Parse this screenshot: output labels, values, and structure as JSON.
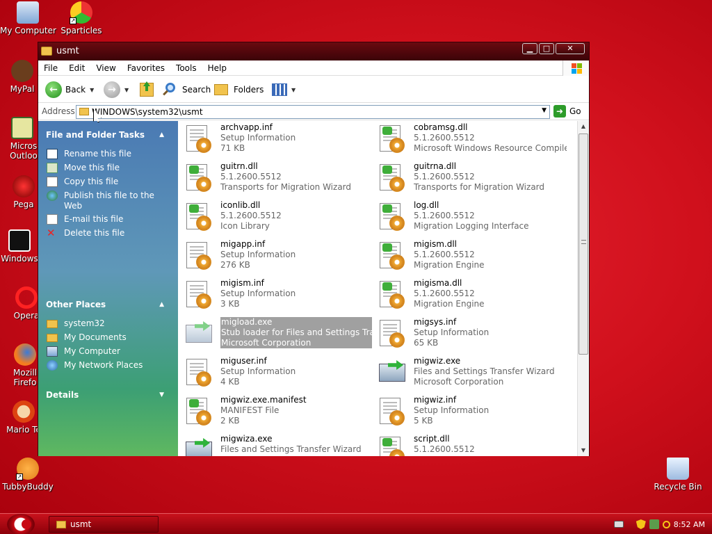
{
  "desktop": {
    "icons": [
      {
        "label": "My Computer"
      },
      {
        "label": "Sparticles"
      },
      {
        "label": "MyPal"
      },
      {
        "label": "Micros Outloo"
      },
      {
        "label": "Pega"
      },
      {
        "label": "Windows"
      },
      {
        "label": "Opera"
      },
      {
        "label": "Mozill Firefo"
      },
      {
        "label": "Mario Te"
      },
      {
        "label": "TubbyBuddy"
      },
      {
        "label": "Recycle Bin"
      }
    ]
  },
  "window": {
    "title": "usmt",
    "controls": {
      "minimize": "▁",
      "maximize": "□",
      "close": "✕"
    },
    "menu": [
      "File",
      "Edit",
      "View",
      "Favorites",
      "Tools",
      "Help"
    ],
    "toolbar": {
      "back": "Back",
      "search": "Search",
      "folders": "Folders"
    },
    "address": {
      "label": "Address",
      "value": "WINDOWS\\system32\\usmt",
      "go": "Go"
    }
  },
  "taskpane": {
    "file_folder_tasks": {
      "title": "File and Folder Tasks",
      "items": [
        "Rename this file",
        "Move this file",
        "Copy this file",
        "Publish this file to the Web",
        "E-mail this file",
        "Delete this file"
      ]
    },
    "other_places": {
      "title": "Other Places",
      "items": [
        "system32",
        "My Documents",
        "My Computer",
        "My Network Places"
      ]
    },
    "details": {
      "title": "Details"
    }
  },
  "files": [
    {
      "name": "archvapp.inf",
      "line2": "Setup Information",
      "line3": "71 KB",
      "icon": "setup-inf-icon"
    },
    {
      "name": "cobramsg.dll",
      "line2": "5.1.2600.5512",
      "line3": "Microsoft Windows Resource Compiler ...",
      "icon": "dll-icon"
    },
    {
      "name": "guitrn.dll",
      "line2": "5.1.2600.5512",
      "line3": "Transports for Migration Wizard",
      "icon": "dll-icon"
    },
    {
      "name": "guitrna.dll",
      "line2": "5.1.2600.5512",
      "line3": "Transports for Migration Wizard",
      "icon": "dll-icon"
    },
    {
      "name": "iconlib.dll",
      "line2": "5.1.2600.5512",
      "line3": "Icon Library",
      "icon": "dll-icon"
    },
    {
      "name": "log.dll",
      "line2": "5.1.2600.5512",
      "line3": "Migration Logging Interface",
      "icon": "dll-icon"
    },
    {
      "name": "migapp.inf",
      "line2": "Setup Information",
      "line3": "276 KB",
      "icon": "setup-inf-icon"
    },
    {
      "name": "migism.dll",
      "line2": "5.1.2600.5512",
      "line3": "Migration Engine",
      "icon": "dll-icon"
    },
    {
      "name": "migism.inf",
      "line2": "Setup Information",
      "line3": "3 KB",
      "icon": "setup-inf-icon"
    },
    {
      "name": "migisma.dll",
      "line2": "5.1.2600.5512",
      "line3": "Migration Engine",
      "icon": "dll-icon"
    },
    {
      "name": "migload.exe",
      "line2": "Stub loader for Files and Settings Transf...",
      "line3": "Microsoft Corporation",
      "icon": "exe-icon",
      "selected": true
    },
    {
      "name": "migsys.inf",
      "line2": "Setup Information",
      "line3": "65 KB",
      "icon": "setup-inf-icon"
    },
    {
      "name": "miguser.inf",
      "line2": "Setup Information",
      "line3": "4 KB",
      "icon": "setup-inf-icon"
    },
    {
      "name": "migwiz.exe",
      "line2": "Files and Settings Transfer Wizard",
      "line3": "Microsoft Corporation",
      "icon": "exe-icon"
    },
    {
      "name": "migwiz.exe.manifest",
      "line2": "MANIFEST File",
      "line3": "2 KB",
      "icon": "dll-icon"
    },
    {
      "name": "migwiz.inf",
      "line2": "Setup Information",
      "line3": "5 KB",
      "icon": "setup-inf-icon"
    },
    {
      "name": "migwiza.exe",
      "line2": "Files and Settings Transfer Wizard",
      "line3": "",
      "icon": "exe-icon"
    },
    {
      "name": "script.dll",
      "line2": "5.1.2600.5512",
      "line3": "",
      "icon": "dll-icon"
    }
  ],
  "taskbar": {
    "item": "usmt",
    "clock": "8:52 AM"
  },
  "colors": {
    "desktop": "#d0101c",
    "taskpane_top": "#4a7ab3",
    "taskpane_bottom": "#5fb860",
    "selection": "#a0a0a0"
  }
}
